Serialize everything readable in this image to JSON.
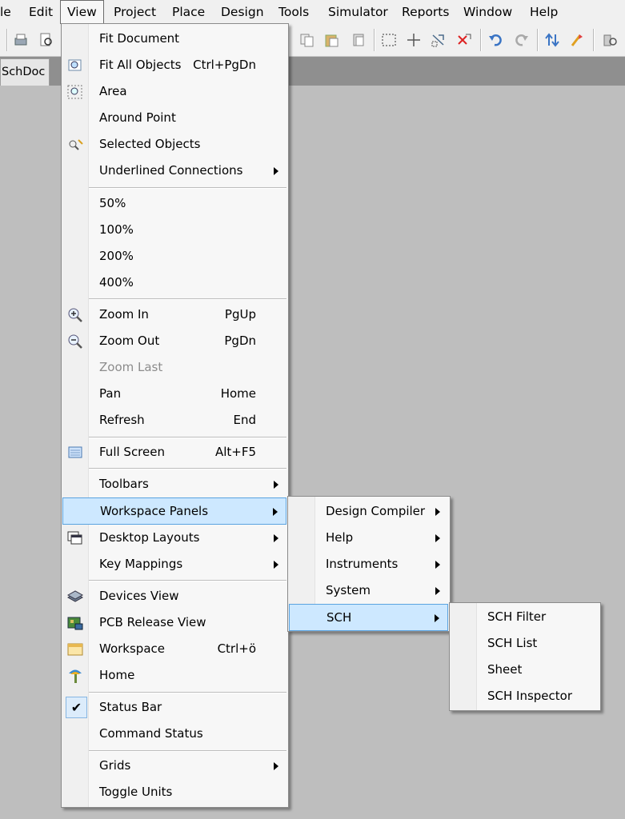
{
  "menubar": {
    "items": [
      {
        "label": "le"
      },
      {
        "label": "Edit"
      },
      {
        "label": "View"
      },
      {
        "label": "Project"
      },
      {
        "label": "Place"
      },
      {
        "label": "Design"
      },
      {
        "label": "Tools"
      },
      {
        "label": "Simulator"
      },
      {
        "label": "Reports"
      },
      {
        "label": "Window"
      },
      {
        "label": "Help"
      }
    ],
    "active": "View"
  },
  "document_tab": {
    "label": "SchDoc"
  },
  "view_menu": {
    "items": [
      {
        "label": "Fit Document",
        "shortcut": "",
        "icon": "none"
      },
      {
        "label": "Fit All Objects",
        "shortcut": "Ctrl+PgDn",
        "icon": "fit-all-objects-icon"
      },
      {
        "label": "Area",
        "shortcut": "",
        "icon": "zoom-area-icon"
      },
      {
        "label": "Around Point",
        "shortcut": "",
        "icon": "none"
      },
      {
        "label": "Selected Objects",
        "shortcut": "",
        "icon": "zoom-selected-icon"
      },
      {
        "label": "Underlined Connections",
        "shortcut": "",
        "submenu": true
      },
      {
        "label": "50%",
        "shortcut": ""
      },
      {
        "label": "100%",
        "shortcut": ""
      },
      {
        "label": "200%",
        "shortcut": ""
      },
      {
        "label": "400%",
        "shortcut": ""
      },
      {
        "label": "Zoom In",
        "shortcut": "PgUp",
        "icon": "zoom-in-icon"
      },
      {
        "label": "Zoom Out",
        "shortcut": "PgDn",
        "icon": "zoom-out-icon"
      },
      {
        "label": "Zoom Last",
        "shortcut": "",
        "disabled": true
      },
      {
        "label": "Pan",
        "shortcut": "Home"
      },
      {
        "label": "Refresh",
        "shortcut": "End"
      },
      {
        "label": "Full Screen",
        "shortcut": "Alt+F5",
        "icon": "full-screen-icon"
      },
      {
        "label": "Toolbars",
        "shortcut": "",
        "submenu": true
      },
      {
        "label": "Workspace Panels",
        "shortcut": "",
        "submenu": true,
        "highlighted": true
      },
      {
        "label": "Desktop Layouts",
        "shortcut": "",
        "submenu": true,
        "icon": "desktop-layouts-icon"
      },
      {
        "label": "Key Mappings",
        "shortcut": "",
        "submenu": true
      },
      {
        "label": "Devices View",
        "shortcut": "",
        "icon": "devices-view-icon"
      },
      {
        "label": "PCB Release View",
        "shortcut": "",
        "icon": "pcb-release-icon"
      },
      {
        "label": "Workspace",
        "shortcut": "Ctrl+ö",
        "icon": "workspace-icon"
      },
      {
        "label": "Home",
        "shortcut": "",
        "icon": "home-icon"
      },
      {
        "label": "Status Bar",
        "shortcut": "",
        "checked": true
      },
      {
        "label": "Command Status",
        "shortcut": ""
      },
      {
        "label": "Grids",
        "shortcut": "",
        "submenu": true
      },
      {
        "label": "Toggle Units",
        "shortcut": ""
      }
    ]
  },
  "workspace_panels_menu": {
    "items": [
      {
        "label": "Design Compiler"
      },
      {
        "label": "Help"
      },
      {
        "label": "Instruments"
      },
      {
        "label": "System"
      },
      {
        "label": "SCH",
        "highlighted": true
      }
    ]
  },
  "sch_menu": {
    "items": [
      {
        "label": "SCH Filter"
      },
      {
        "label": "SCH List"
      },
      {
        "label": "Sheet"
      },
      {
        "label": "SCH Inspector"
      }
    ]
  },
  "colors": {
    "highlight_fill": "#cde8ff",
    "highlight_border": "#5aa3e0",
    "disabled_text": "#8c8c8c"
  }
}
